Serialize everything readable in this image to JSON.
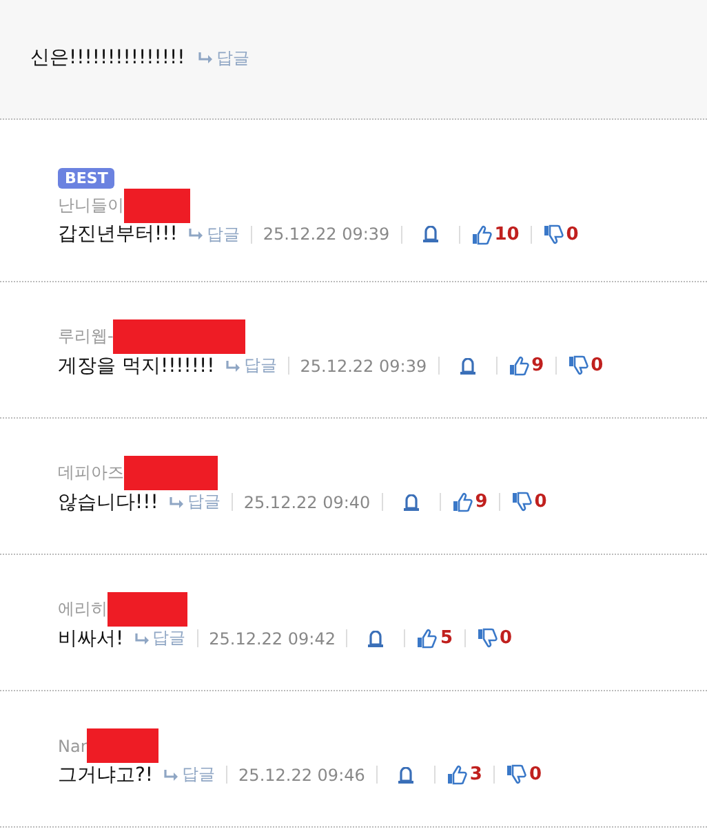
{
  "parent_comment": {
    "text": "신은!!!!!!!!!!!!!!!",
    "reply_label": "답글"
  },
  "replies": [
    {
      "best": true,
      "badge": "BEST",
      "author": "난니들이",
      "text": "갑진년부터!!!",
      "reply_label": "답글",
      "time": "25.12.22 09:39",
      "likes": "10",
      "dislikes": "0"
    },
    {
      "best": false,
      "author": "루리웹-",
      "text": "게장을 먹지!!!!!!!",
      "reply_label": "답글",
      "time": "25.12.22 09:39",
      "likes": "9",
      "dislikes": "0"
    },
    {
      "best": false,
      "author": "데피아즈",
      "text": "않습니다!!!",
      "reply_label": "답글",
      "time": "25.12.22 09:40",
      "likes": "9",
      "dislikes": "0"
    },
    {
      "best": false,
      "author": "에리히",
      "text": "비싸서!",
      "reply_label": "답글",
      "time": "25.12.22 09:42",
      "likes": "5",
      "dislikes": "0"
    },
    {
      "best": false,
      "author": "Nar",
      "text": "그거냐고?!",
      "reply_label": "답글",
      "time": "25.12.22 09:46",
      "likes": "3",
      "dislikes": "0"
    }
  ]
}
